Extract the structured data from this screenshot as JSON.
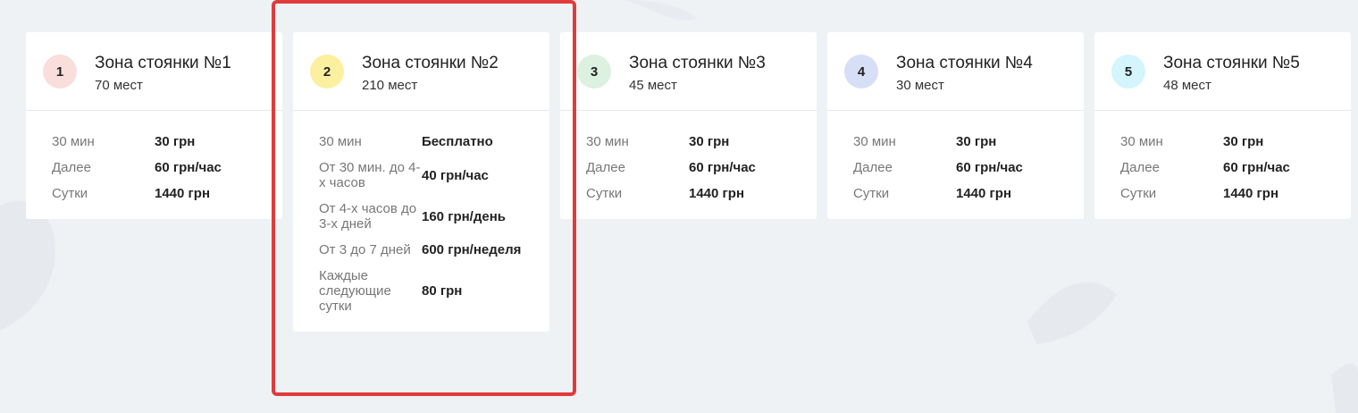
{
  "zones": [
    {
      "number": "1",
      "title": "Зона стоянки №1",
      "places": "70 мест",
      "badge_color": "#f9dedc",
      "rates": [
        {
          "label": "30 мин",
          "value": "30 грн"
        },
        {
          "label": "Далее",
          "value": "60 грн/час"
        },
        {
          "label": "Сутки",
          "value": "1440 грн"
        }
      ]
    },
    {
      "number": "2",
      "title": "Зона стоянки №2",
      "places": "210 мест",
      "badge_color": "#fbf0a0",
      "rates": [
        {
          "label": "30 мин",
          "value": "Бесплатно"
        },
        {
          "label": "От 30 мин. до 4-х часов",
          "value": "40 грн/час"
        },
        {
          "label": "От 4-х часов до 3-х дней",
          "value": "160 грн/день"
        },
        {
          "label": "От 3 до 7 дней",
          "value": "600 грн/неделя"
        },
        {
          "label": "Каждые следующие сутки",
          "value": "80 грн"
        }
      ]
    },
    {
      "number": "3",
      "title": "Зона стоянки №3",
      "places": "45 мест",
      "badge_color": "#dcf1e0",
      "rates": [
        {
          "label": "30 мин",
          "value": "30 грн"
        },
        {
          "label": "Далее",
          "value": "60 грн/час"
        },
        {
          "label": "Сутки",
          "value": "1440 грн"
        }
      ]
    },
    {
      "number": "4",
      "title": "Зона стоянки №4",
      "places": "30 мест",
      "badge_color": "#d6dff5",
      "rates": [
        {
          "label": "30 мин",
          "value": "30 грн"
        },
        {
          "label": "Далее",
          "value": "60 грн/час"
        },
        {
          "label": "Сутки",
          "value": "1440 грн"
        }
      ]
    },
    {
      "number": "5",
      "title": "Зона стоянки №5",
      "places": "48 мест",
      "badge_color": "#d3f5fb",
      "rates": [
        {
          "label": "30 мин",
          "value": "30 грн"
        },
        {
          "label": "Далее",
          "value": "60 грн/час"
        },
        {
          "label": "Сутки",
          "value": "1440 грн"
        }
      ]
    }
  ],
  "highlight_color": "#e03b3b"
}
